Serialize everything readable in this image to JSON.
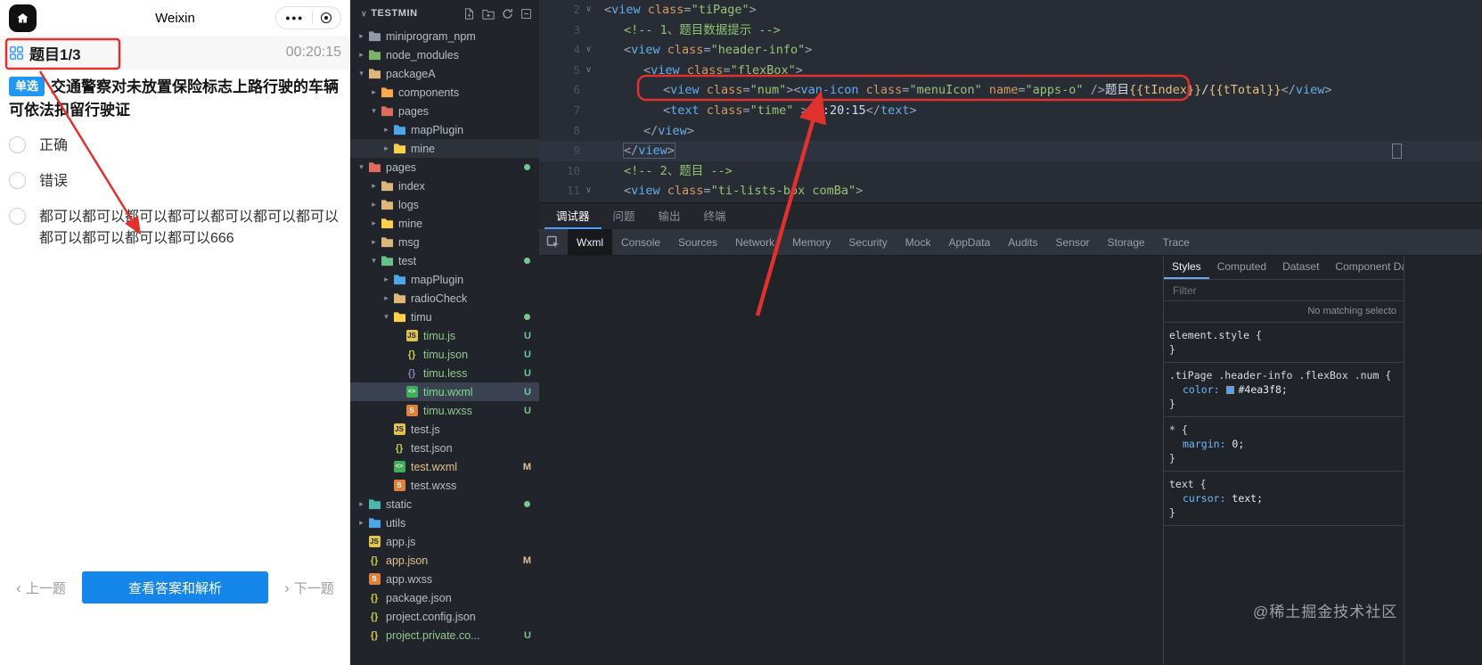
{
  "colors": {
    "annotation_red": "#e0312f",
    "accent_blue": "#4ea3f8",
    "badge_blue": "#2196f3",
    "primary_button_blue": "#1486ea"
  },
  "simulator": {
    "title": "Weixin",
    "header": {
      "question_index": "题目1/3",
      "timer": "00:20:15"
    },
    "question": {
      "badge": "单选",
      "text": "交通警察对未放置保险标志上路行驶的车辆可依法扣留行驶证"
    },
    "options": [
      "正确",
      "错误",
      "都可以都可以都可以都可以都可以都可以都可以都可以都可以都可以都可以666"
    ],
    "footer": {
      "prev": "上一题",
      "answer": "查看答案和解析",
      "next": "下一题"
    }
  },
  "file_tree": {
    "title": "TESTMIN",
    "items": [
      {
        "label": "miniprogram_npm",
        "level": 1,
        "kind": "folder",
        "chevron": "closed",
        "color": "#8f9ba8"
      },
      {
        "label": "node_modules",
        "level": 1,
        "kind": "folder",
        "chevron": "closed",
        "color": "#7cb36b"
      },
      {
        "label": "packageA",
        "level": 1,
        "kind": "folder",
        "chevron": "open",
        "color": "#dcb67a"
      },
      {
        "label": "components",
        "level": 2,
        "kind": "folder",
        "chevron": "closed",
        "color": "#ffa94d"
      },
      {
        "label": "pages",
        "level": 2,
        "kind": "folder",
        "chevron": "open",
        "color": "#e06b5f"
      },
      {
        "label": "mapPlugin",
        "level": 3,
        "kind": "folder",
        "chevron": "closed",
        "color": "#4da6e8"
      },
      {
        "label": "mine",
        "level": 3,
        "kind": "folder",
        "chevron": "closed",
        "color": "#ffd04d",
        "row": "hover"
      },
      {
        "label": "pages",
        "level": 1,
        "kind": "folder",
        "chevron": "open",
        "color": "#e06b5f",
        "dot": true
      },
      {
        "label": "index",
        "level": 2,
        "kind": "folder",
        "chevron": "closed",
        "color": "#dcb67a"
      },
      {
        "label": "logs",
        "level": 2,
        "kind": "folder",
        "chevron": "closed",
        "color": "#dcb67a"
      },
      {
        "label": "mine",
        "level": 2,
        "kind": "folder",
        "chevron": "closed",
        "color": "#ffd04d"
      },
      {
        "label": "msg",
        "level": 2,
        "kind": "folder",
        "chevron": "closed",
        "color": "#dcb67a"
      },
      {
        "label": "test",
        "level": 2,
        "kind": "folder",
        "chevron": "open",
        "color": "#62c28a",
        "dot": true
      },
      {
        "label": "mapPlugin",
        "level": 3,
        "kind": "folder",
        "chevron": "closed",
        "color": "#4da6e8"
      },
      {
        "label": "radioCheck",
        "level": 3,
        "kind": "folder",
        "chevron": "closed",
        "color": "#dcb67a"
      },
      {
        "label": "timu",
        "level": 3,
        "kind": "folder",
        "chevron": "open",
        "color": "#ffd04d",
        "dot": true
      },
      {
        "label": "timu.js",
        "level": 4,
        "kind": "js",
        "badge": "U",
        "text_color": "#8fc98f"
      },
      {
        "label": "timu.json",
        "level": 4,
        "kind": "json",
        "badge": "U",
        "text_color": "#8fc98f"
      },
      {
        "label": "timu.less",
        "level": 4,
        "kind": "less",
        "badge": "U",
        "text_color": "#8fc98f"
      },
      {
        "label": "timu.wxml",
        "level": 4,
        "kind": "wxml",
        "badge": "U",
        "row": "selected",
        "text_color": "#7ee08a"
      },
      {
        "label": "timu.wxss",
        "level": 4,
        "kind": "wxss",
        "badge": "U",
        "text_color": "#8fc98f"
      },
      {
        "label": "test.js",
        "level": 3,
        "kind": "js"
      },
      {
        "label": "test.json",
        "level": 3,
        "kind": "json"
      },
      {
        "label": "test.wxml",
        "level": 3,
        "kind": "wxml",
        "badge": "M",
        "text_color": "#e2c08d"
      },
      {
        "label": "test.wxss",
        "level": 3,
        "kind": "wxss"
      },
      {
        "label": "static",
        "level": 1,
        "kind": "folder",
        "chevron": "closed",
        "color": "#4db6ac",
        "dot": true
      },
      {
        "label": "utils",
        "level": 1,
        "kind": "folder",
        "chevron": "closed",
        "color": "#4da6e8"
      },
      {
        "label": "app.js",
        "level": 1,
        "kind": "js"
      },
      {
        "label": "app.json",
        "level": 1,
        "kind": "json",
        "badge": "M",
        "text_color": "#e2c08d"
      },
      {
        "label": "app.wxss",
        "level": 1,
        "kind": "wxss"
      },
      {
        "label": "package.json",
        "level": 1,
        "kind": "json"
      },
      {
        "label": "project.config.json",
        "level": 1,
        "kind": "json"
      },
      {
        "label": "project.private.co...",
        "level": 1,
        "kind": "json",
        "badge": "U",
        "text_color": "#8fc98f"
      }
    ]
  },
  "editor": {
    "lines": [
      {
        "n": 2,
        "ind": 0,
        "fold": true,
        "tok": [
          [
            "p",
            "<"
          ],
          [
            "t",
            "view"
          ],
          [
            "w",
            " "
          ],
          [
            "a",
            "class"
          ],
          [
            "p",
            "="
          ],
          [
            "s",
            "\"tiPage\""
          ],
          [
            "p",
            ">"
          ]
        ]
      },
      {
        "n": 3,
        "ind": 1,
        "tok": [
          [
            "c",
            "<!-- 1、题目数据提示 -->"
          ]
        ]
      },
      {
        "n": 4,
        "ind": 1,
        "fold": true,
        "tok": [
          [
            "p",
            "<"
          ],
          [
            "t",
            "view"
          ],
          [
            "w",
            " "
          ],
          [
            "a",
            "class"
          ],
          [
            "p",
            "="
          ],
          [
            "s",
            "\"header-info\""
          ],
          [
            "p",
            ">"
          ]
        ]
      },
      {
        "n": 5,
        "ind": 2,
        "fold": true,
        "tok": [
          [
            "p",
            "<"
          ],
          [
            "t",
            "view"
          ],
          [
            "w",
            " "
          ],
          [
            "a",
            "class"
          ],
          [
            "p",
            "="
          ],
          [
            "s",
            "\"flexBox\""
          ],
          [
            "p",
            ">"
          ]
        ]
      },
      {
        "n": 6,
        "ind": 3,
        "tok": [
          [
            "p",
            "<"
          ],
          [
            "t",
            "view"
          ],
          [
            "w",
            " "
          ],
          [
            "a",
            "class"
          ],
          [
            "p",
            "="
          ],
          [
            "s",
            "\"num\""
          ],
          [
            "p",
            "><"
          ],
          [
            "t",
            "van-icon"
          ],
          [
            "w",
            " "
          ],
          [
            "a",
            "class"
          ],
          [
            "p",
            "="
          ],
          [
            "s",
            "\"menuIcon\""
          ],
          [
            "w",
            " "
          ],
          [
            "a",
            "name"
          ],
          [
            "p",
            "="
          ],
          [
            "s",
            "\"apps-o\""
          ],
          [
            "w",
            " "
          ],
          [
            "p",
            "/>"
          ],
          [
            "x",
            "题目"
          ],
          [
            "m",
            "{{tIndex}}"
          ],
          [
            "x",
            "/"
          ],
          [
            "m",
            "{{tTotal}}"
          ],
          [
            "p",
            "</"
          ],
          [
            "t",
            "view"
          ],
          [
            "p",
            ">"
          ]
        ]
      },
      {
        "n": 7,
        "ind": 3,
        "tok": [
          [
            "p",
            "<"
          ],
          [
            "t",
            "text"
          ],
          [
            "w",
            " "
          ],
          [
            "a",
            "class"
          ],
          [
            "p",
            "="
          ],
          [
            "s",
            "\"time\""
          ],
          [
            "w",
            " "
          ],
          [
            "p",
            ">"
          ],
          [
            "x",
            "00:20:15"
          ],
          [
            "p",
            "</"
          ],
          [
            "t",
            "text"
          ],
          [
            "p",
            ">"
          ]
        ]
      },
      {
        "n": 8,
        "ind": 2,
        "tok": [
          [
            "p",
            "</"
          ],
          [
            "t",
            "view"
          ],
          [
            "p",
            ">"
          ]
        ]
      },
      {
        "n": 9,
        "ind": 1,
        "cur": true,
        "tok": [
          [
            "p",
            "</"
          ],
          [
            "t",
            "view"
          ],
          [
            "p",
            ">"
          ]
        ]
      },
      {
        "n": 10,
        "ind": 1,
        "tok": [
          [
            "c",
            "<!-- 2、题目 -->"
          ]
        ]
      },
      {
        "n": 11,
        "ind": 1,
        "fold": true,
        "tok": [
          [
            "p",
            "<"
          ],
          [
            "t",
            "view"
          ],
          [
            "w",
            " "
          ],
          [
            "a",
            "class"
          ],
          [
            "p",
            "="
          ],
          [
            "s",
            "\"ti-lists-box comBa\""
          ],
          [
            "p",
            ">"
          ]
        ]
      }
    ]
  },
  "debugger": {
    "tabs": [
      {
        "label": "调试器",
        "active": true
      },
      {
        "label": "问题"
      },
      {
        "label": "输出"
      },
      {
        "label": "终端"
      }
    ],
    "devtools_tabs": [
      {
        "label": "Wxml",
        "active": true
      },
      {
        "label": "Console"
      },
      {
        "label": "Sources"
      },
      {
        "label": "Network"
      },
      {
        "label": "Memory"
      },
      {
        "label": "Security"
      },
      {
        "label": "Mock"
      },
      {
        "label": "AppData"
      },
      {
        "label": "Audits"
      },
      {
        "label": "Sensor"
      },
      {
        "label": "Storage"
      },
      {
        "label": "Trace"
      }
    ],
    "styles_panel": {
      "tabs": [
        {
          "label": "Styles",
          "active": true
        },
        {
          "label": "Computed"
        },
        {
          "label": "Dataset"
        },
        {
          "label": "Component Data"
        }
      ],
      "filter_placeholder": "Filter",
      "no_match_text": "No matching selecto",
      "rules": [
        {
          "selector": "element.style",
          "props": []
        },
        {
          "selector": ".tiPage .header-info .flexBox .num",
          "props": [
            {
              "name": "color",
              "value": "#4ea3f8",
              "swatch": "#4ea3f8"
            }
          ]
        },
        {
          "selector": "*",
          "props": [
            {
              "name": "margin",
              "value": "0"
            }
          ]
        },
        {
          "selector": "text",
          "props": [
            {
              "name": "cursor",
              "value": "text"
            }
          ]
        }
      ]
    }
  },
  "watermark": "@稀土掘金技术社区"
}
